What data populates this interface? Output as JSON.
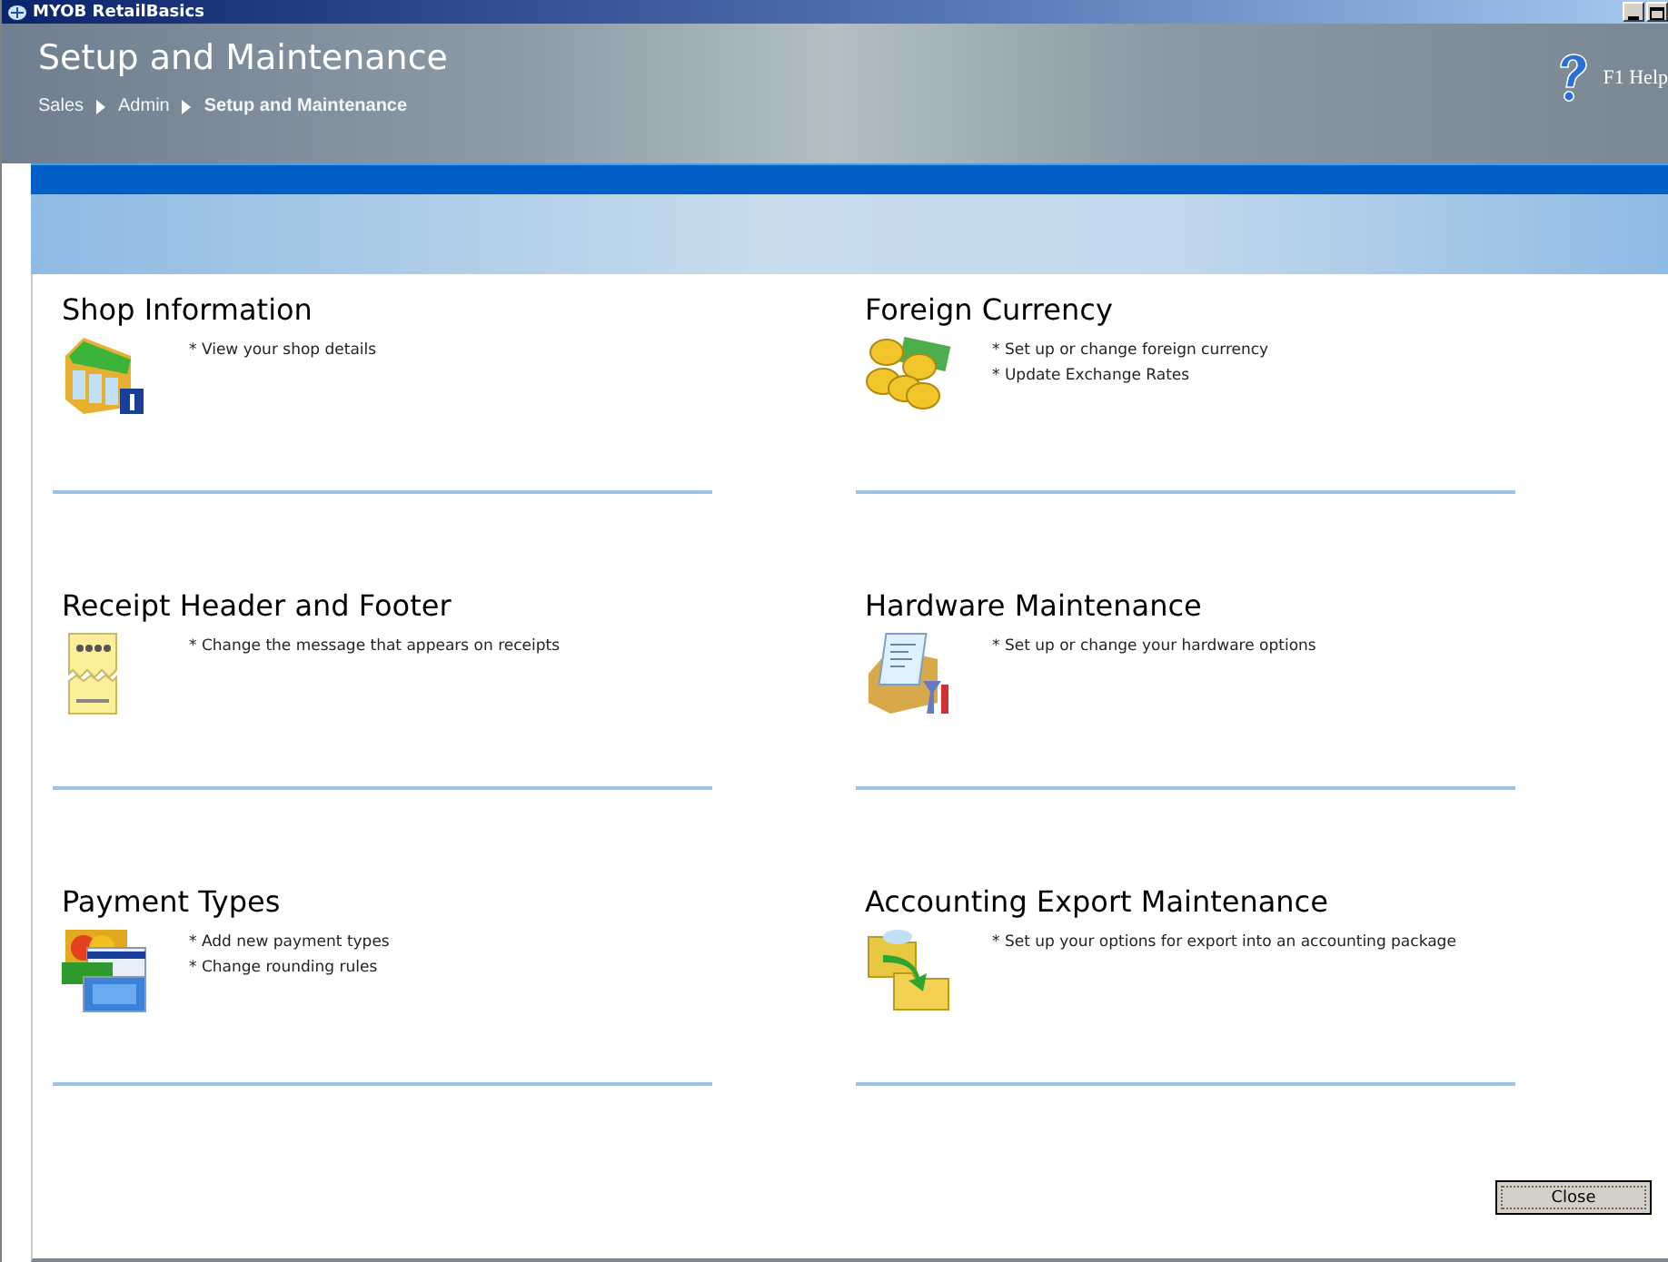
{
  "window": {
    "title": "MYOB RetailBasics"
  },
  "header": {
    "title": "Setup and Maintenance",
    "breadcrumb": [
      {
        "label": "Sales",
        "current": false
      },
      {
        "label": "Admin",
        "current": false
      },
      {
        "label": "Setup and Maintenance",
        "current": true
      }
    ],
    "help": "F1 Help"
  },
  "sections": [
    {
      "title": "Shop Information",
      "items": [
        "* View your shop details"
      ]
    },
    {
      "title": "Foreign Currency",
      "items": [
        "* Set up or change foreign currency",
        "* Update Exchange Rates"
      ]
    },
    {
      "title": "Receipt Header and Footer",
      "items": [
        "* Change the message that appears on receipts"
      ]
    },
    {
      "title": "Hardware Maintenance",
      "items": [
        "* Set up or change your hardware options"
      ]
    },
    {
      "title": "Payment Types",
      "items": [
        "* Add new payment types",
        "* Change rounding rules"
      ]
    },
    {
      "title": "Accounting Export Maintenance",
      "items": [
        "* Set up your options for export into an accounting package"
      ]
    }
  ],
  "buttons": [
    "Close"
  ]
}
